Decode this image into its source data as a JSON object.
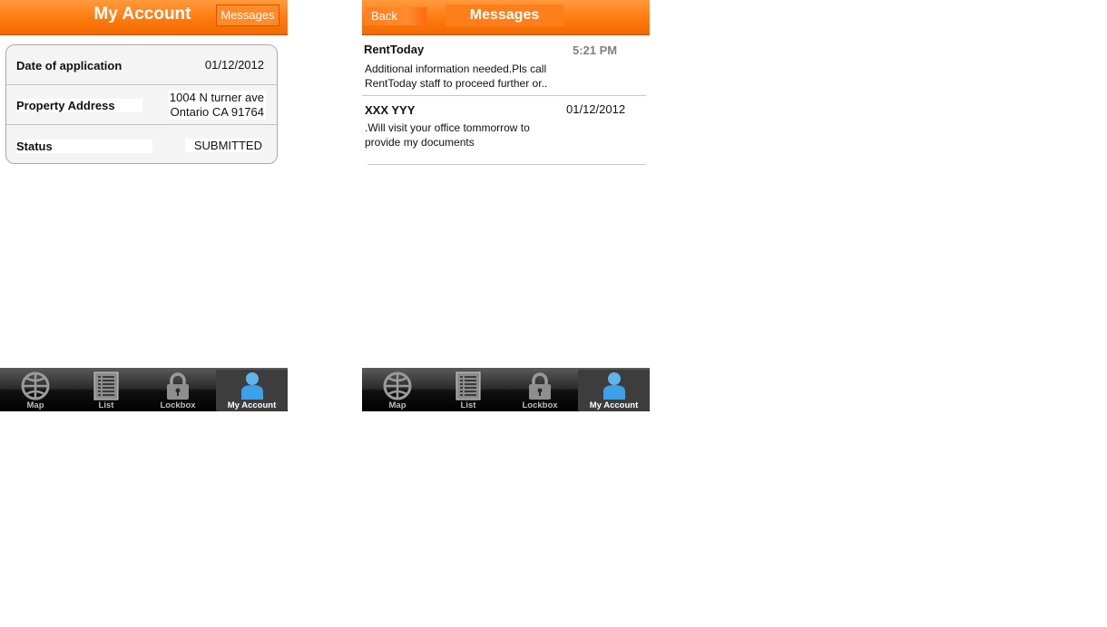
{
  "tabbar": {
    "tabs": [
      {
        "label": "Map",
        "icon": "globe-icon"
      },
      {
        "label": "List",
        "icon": "list-icon"
      },
      {
        "label": "Lockbox",
        "icon": "lock-icon"
      },
      {
        "label": "My Account",
        "icon": "person-icon",
        "selected": true
      }
    ]
  },
  "account": {
    "title": "My Account",
    "messages_button": "Messages",
    "rows": [
      {
        "label": "Date of application",
        "value": "01/12/2012"
      },
      {
        "label": "Property Address",
        "value_line1": "1004 N turner ave",
        "value_line2": "Ontario CA 91764"
      },
      {
        "label": "Status",
        "value": "SUBMITTED"
      }
    ]
  },
  "messages": {
    "title": "Messages",
    "back_button": "Back",
    "items": [
      {
        "sender": "RentToday",
        "time": "5:21 PM",
        "body_line1": "Additional information needed.Pls call",
        "body_line2": "RentToday staff to proceed further  or.."
      },
      {
        "sender": "XXX YYY",
        "time": "01/12/2012",
        "body_line1": ".Will visit your office tommorrow to",
        "body_line2": "provide my documents"
      }
    ]
  },
  "colors": {
    "header_orange": "#ff7d12",
    "tabbar_dark": "#111111",
    "selected_icon_blue": "#3ea0e8"
  }
}
